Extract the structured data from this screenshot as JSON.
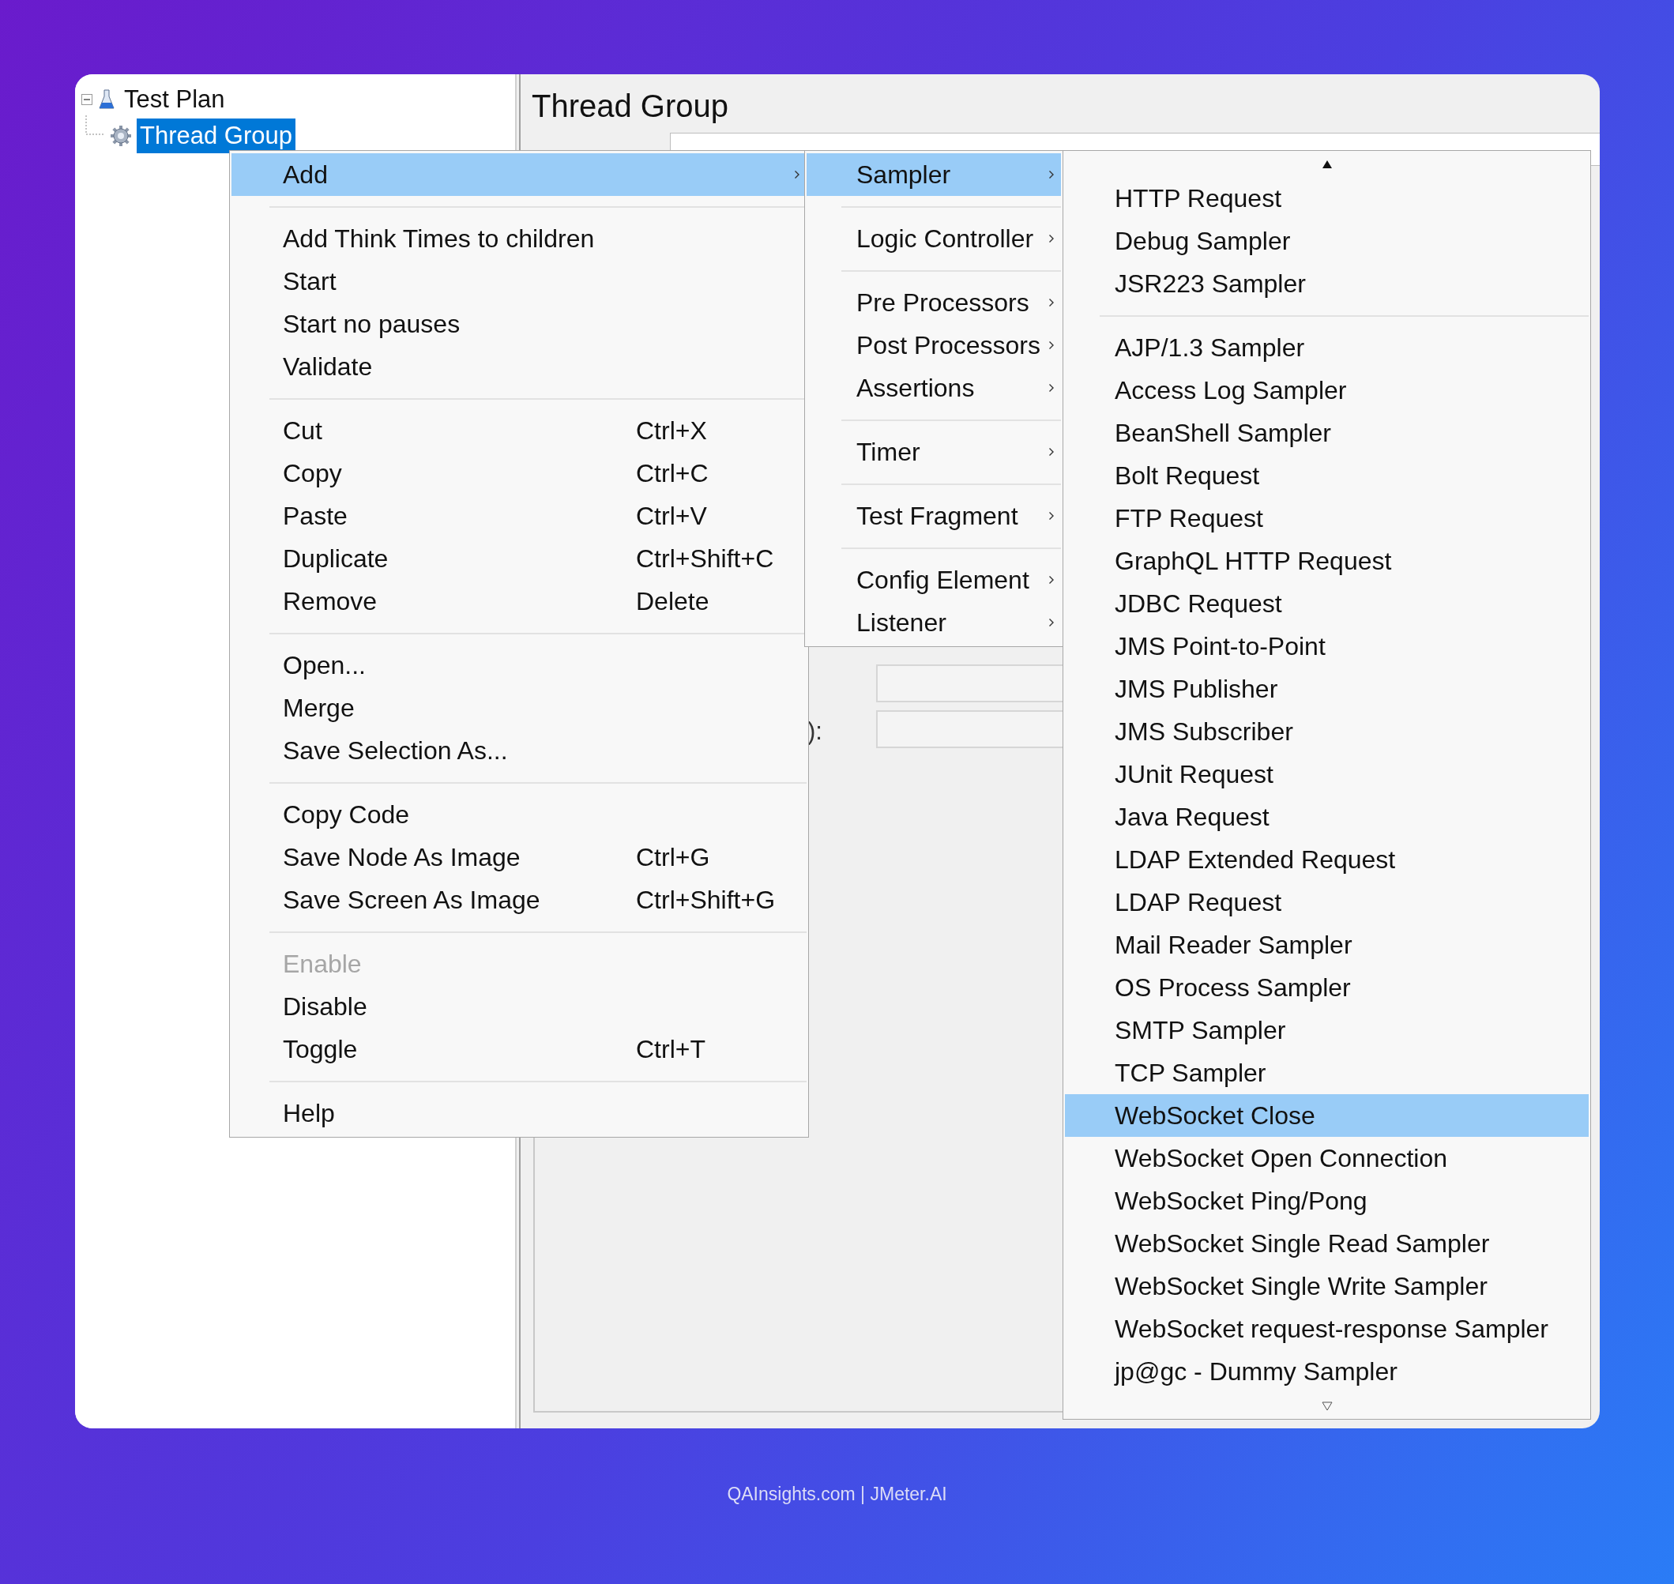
{
  "tree": [
    {
      "label": "Test Plan",
      "expanded": true,
      "selected": false,
      "children": [
        {
          "label": "Thread Group",
          "selected": true
        }
      ]
    }
  ],
  "panel": {
    "title": "Thread Group",
    "fragment": "):"
  },
  "context_menu": {
    "items": [
      {
        "kind": "submenu",
        "label": "Add",
        "selected": true,
        "disabled": false
      },
      {
        "kind": "separator"
      },
      {
        "kind": "item",
        "label": "Add Think Times to children",
        "selected": false,
        "disabled": false
      },
      {
        "kind": "item",
        "label": "Start",
        "selected": false,
        "disabled": false
      },
      {
        "kind": "item",
        "label": "Start no pauses",
        "selected": false,
        "disabled": false
      },
      {
        "kind": "item",
        "label": "Validate",
        "selected": false,
        "disabled": false
      },
      {
        "kind": "separator"
      },
      {
        "kind": "item",
        "label": "Cut",
        "shortcut": "Ctrl+X",
        "selected": false,
        "disabled": false
      },
      {
        "kind": "item",
        "label": "Copy",
        "shortcut": "Ctrl+C",
        "selected": false,
        "disabled": false
      },
      {
        "kind": "item",
        "label": "Paste",
        "shortcut": "Ctrl+V",
        "selected": false,
        "disabled": false
      },
      {
        "kind": "item",
        "label": "Duplicate",
        "shortcut": "Ctrl+Shift+C",
        "selected": false,
        "disabled": false
      },
      {
        "kind": "item",
        "label": "Remove",
        "shortcut": "Delete",
        "selected": false,
        "disabled": false
      },
      {
        "kind": "separator"
      },
      {
        "kind": "item",
        "label": "Open...",
        "selected": false,
        "disabled": false
      },
      {
        "kind": "item",
        "label": "Merge",
        "selected": false,
        "disabled": false
      },
      {
        "kind": "item",
        "label": "Save Selection As...",
        "selected": false,
        "disabled": false
      },
      {
        "kind": "separator"
      },
      {
        "kind": "item",
        "label": "Copy Code",
        "selected": false,
        "disabled": false
      },
      {
        "kind": "item",
        "label": "Save Node As Image",
        "shortcut": "Ctrl+G",
        "selected": false,
        "disabled": false
      },
      {
        "kind": "item",
        "label": "Save Screen As Image",
        "shortcut": "Ctrl+Shift+G",
        "selected": false,
        "disabled": false
      },
      {
        "kind": "separator"
      },
      {
        "kind": "item",
        "label": "Enable",
        "selected": false,
        "disabled": true
      },
      {
        "kind": "item",
        "label": "Disable",
        "selected": false,
        "disabled": false
      },
      {
        "kind": "item",
        "label": "Toggle",
        "shortcut": "Ctrl+T",
        "selected": false,
        "disabled": false
      },
      {
        "kind": "separator"
      },
      {
        "kind": "item",
        "label": "Help",
        "selected": false,
        "disabled": false
      }
    ]
  },
  "add_menu": {
    "items": [
      {
        "kind": "submenu",
        "label": "Sampler",
        "selected": true
      },
      {
        "kind": "separator"
      },
      {
        "kind": "submenu",
        "label": "Logic Controller",
        "selected": false
      },
      {
        "kind": "separator"
      },
      {
        "kind": "submenu",
        "label": "Pre Processors",
        "selected": false
      },
      {
        "kind": "submenu",
        "label": "Post Processors",
        "selected": false
      },
      {
        "kind": "submenu",
        "label": "Assertions",
        "selected": false
      },
      {
        "kind": "separator"
      },
      {
        "kind": "submenu",
        "label": "Timer",
        "selected": false
      },
      {
        "kind": "separator"
      },
      {
        "kind": "submenu",
        "label": "Test Fragment",
        "selected": false
      },
      {
        "kind": "separator"
      },
      {
        "kind": "submenu",
        "label": "Config Element",
        "selected": false
      },
      {
        "kind": "submenu",
        "label": "Listener",
        "selected": false
      }
    ]
  },
  "sampler_menu": {
    "items": [
      {
        "kind": "item",
        "label": "HTTP Request",
        "selected": false
      },
      {
        "kind": "item",
        "label": "Debug Sampler",
        "selected": false
      },
      {
        "kind": "item",
        "label": "JSR223 Sampler",
        "selected": false
      },
      {
        "kind": "separator"
      },
      {
        "kind": "item",
        "label": "AJP/1.3 Sampler",
        "selected": false
      },
      {
        "kind": "item",
        "label": "Access Log Sampler",
        "selected": false
      },
      {
        "kind": "item",
        "label": "BeanShell Sampler",
        "selected": false
      },
      {
        "kind": "item",
        "label": "Bolt Request",
        "selected": false
      },
      {
        "kind": "item",
        "label": "FTP Request",
        "selected": false
      },
      {
        "kind": "item",
        "label": "GraphQL HTTP Request",
        "selected": false
      },
      {
        "kind": "item",
        "label": "JDBC Request",
        "selected": false
      },
      {
        "kind": "item",
        "label": "JMS Point-to-Point",
        "selected": false
      },
      {
        "kind": "item",
        "label": "JMS Publisher",
        "selected": false
      },
      {
        "kind": "item",
        "label": "JMS Subscriber",
        "selected": false
      },
      {
        "kind": "item",
        "label": "JUnit Request",
        "selected": false
      },
      {
        "kind": "item",
        "label": "Java Request",
        "selected": false
      },
      {
        "kind": "item",
        "label": "LDAP Extended Request",
        "selected": false
      },
      {
        "kind": "item",
        "label": "LDAP Request",
        "selected": false
      },
      {
        "kind": "item",
        "label": "Mail Reader Sampler",
        "selected": false
      },
      {
        "kind": "item",
        "label": "OS Process Sampler",
        "selected": false
      },
      {
        "kind": "item",
        "label": "SMTP Sampler",
        "selected": false
      },
      {
        "kind": "item",
        "label": "TCP Sampler",
        "selected": false
      },
      {
        "kind": "item",
        "label": "WebSocket Close",
        "selected": true
      },
      {
        "kind": "item",
        "label": "WebSocket Open Connection",
        "selected": false
      },
      {
        "kind": "item",
        "label": "WebSocket Ping/Pong",
        "selected": false
      },
      {
        "kind": "item",
        "label": "WebSocket Single Read Sampler",
        "selected": false
      },
      {
        "kind": "item",
        "label": "WebSocket Single Write Sampler",
        "selected": false
      },
      {
        "kind": "item",
        "label": "WebSocket request-response Sampler",
        "selected": false
      },
      {
        "kind": "item",
        "label": "jp@gc - Dummy Sampler",
        "selected": false
      }
    ]
  },
  "caption": "QAInsights.com | JMeter.AI"
}
